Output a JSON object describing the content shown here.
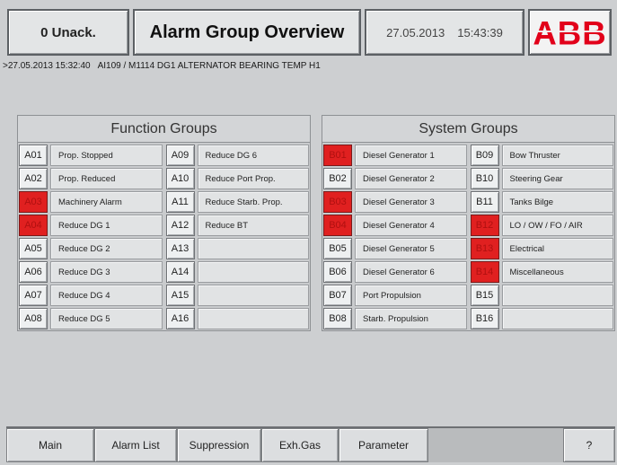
{
  "header": {
    "unack_label": "0 Unack.",
    "title": "Alarm Group Overview",
    "date": "27.05.2013",
    "time": "15:43:39",
    "logo_text": "ABB",
    "logo_color": "#e2001a"
  },
  "alarm_line": {
    "timestamp": ">27.05.2013 15:32:40",
    "text": "AI109 / M1114 DG1 ALTERNATOR BEARING TEMP H1"
  },
  "colors": {
    "active_alarm": "#e02020",
    "background": "#cdcfd1"
  },
  "function_groups": {
    "title": "Function Groups",
    "col1": [
      {
        "code": "A01",
        "label": "Prop. Stopped",
        "active": false
      },
      {
        "code": "A02",
        "label": "Prop. Reduced",
        "active": false
      },
      {
        "code": "A03",
        "label": "Machinery Alarm",
        "active": true
      },
      {
        "code": "A04",
        "label": "Reduce DG 1",
        "active": true
      },
      {
        "code": "A05",
        "label": "Reduce DG 2",
        "active": false
      },
      {
        "code": "A06",
        "label": "Reduce DG 3",
        "active": false
      },
      {
        "code": "A07",
        "label": "Reduce DG 4",
        "active": false
      },
      {
        "code": "A08",
        "label": "Reduce DG 5",
        "active": false
      }
    ],
    "col2": [
      {
        "code": "A09",
        "label": "Reduce DG 6",
        "active": false
      },
      {
        "code": "A10",
        "label": "Reduce Port Prop.",
        "active": false
      },
      {
        "code": "A11",
        "label": "Reduce Starb. Prop.",
        "active": false
      },
      {
        "code": "A12",
        "label": "Reduce BT",
        "active": false
      },
      {
        "code": "A13",
        "label": "",
        "active": false
      },
      {
        "code": "A14",
        "label": "",
        "active": false
      },
      {
        "code": "A15",
        "label": "",
        "active": false
      },
      {
        "code": "A16",
        "label": "",
        "active": false
      }
    ]
  },
  "system_groups": {
    "title": "System Groups",
    "col1": [
      {
        "code": "B01",
        "label": "Diesel Generator 1",
        "active": true
      },
      {
        "code": "B02",
        "label": "Diesel Generator 2",
        "active": false
      },
      {
        "code": "B03",
        "label": "Diesel Generator 3",
        "active": true
      },
      {
        "code": "B04",
        "label": "Diesel Generator 4",
        "active": true
      },
      {
        "code": "B05",
        "label": "Diesel Generator 5",
        "active": false
      },
      {
        "code": "B06",
        "label": "Diesel Generator 6",
        "active": false
      },
      {
        "code": "B07",
        "label": "Port Propulsion",
        "active": false
      },
      {
        "code": "B08",
        "label": "Starb. Propulsion",
        "active": false
      }
    ],
    "col2": [
      {
        "code": "B09",
        "label": "Bow Thruster",
        "active": false
      },
      {
        "code": "B10",
        "label": "Steering Gear",
        "active": false
      },
      {
        "code": "B11",
        "label": "Tanks Bilge",
        "active": false
      },
      {
        "code": "B12",
        "label": "LO / OW / FO / AIR",
        "active": true
      },
      {
        "code": "B13",
        "label": "Electrical",
        "active": true
      },
      {
        "code": "B14",
        "label": "Miscellaneous",
        "active": true
      },
      {
        "code": "B15",
        "label": "",
        "active": false
      },
      {
        "code": "B16",
        "label": "",
        "active": false
      }
    ]
  },
  "bottom_nav": {
    "main": "Main",
    "alarm_list": "Alarm List",
    "suppression": "Suppression",
    "exh_gas": "Exh.Gas",
    "parameter": "Parameter",
    "help": "?"
  }
}
